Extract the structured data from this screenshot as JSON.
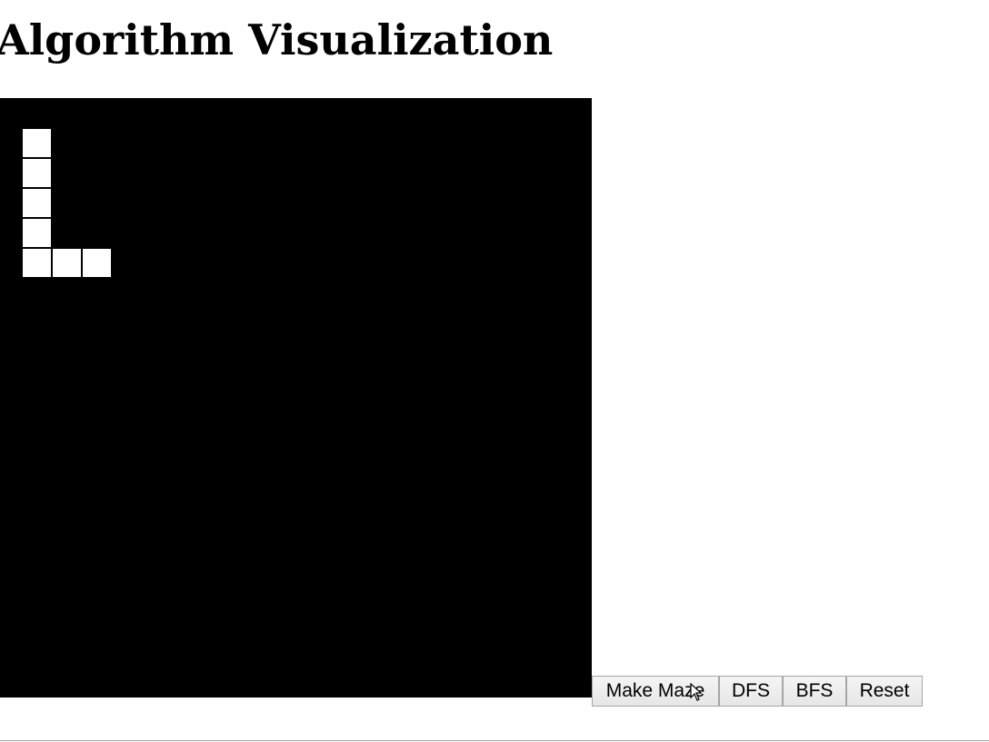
{
  "page": {
    "title": "Algorithm Visualization"
  },
  "grid": {
    "background_color": "#000000",
    "cell_color": "#ffffff",
    "lit_cells": [
      {
        "row": 0,
        "col": 0
      },
      {
        "row": 1,
        "col": 0
      },
      {
        "row": 2,
        "col": 0
      },
      {
        "row": 3,
        "col": 0
      },
      {
        "row": 4,
        "col": 0
      },
      {
        "row": 4,
        "col": 1
      },
      {
        "row": 4,
        "col": 2
      }
    ]
  },
  "controls": {
    "make_maze_label": "Make Maze",
    "dfs_label": "DFS",
    "bfs_label": "BFS",
    "reset_label": "Reset"
  },
  "icons": {
    "cursor": "mouse-pointer-icon"
  }
}
